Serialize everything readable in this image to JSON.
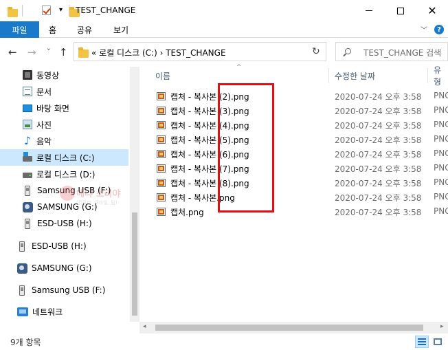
{
  "window": {
    "title": "TEST_CHANGE",
    "minimize_label": "minimize",
    "maximize_label": "maximize",
    "close_glyph": "✕"
  },
  "ribbon": {
    "tabs": [
      "파일",
      "홈",
      "공유",
      "보기"
    ],
    "expand_glyph": "﹀",
    "help_glyph": "?"
  },
  "nav": {
    "back_glyph": "←",
    "forward_glyph": "→",
    "history_glyph": "˅",
    "up_glyph": "↑",
    "refresh_glyph": "↻",
    "address_text": "«  로컬 디스크 (C:)  ›  TEST_CHANGE",
    "search_placeholder": "TEST_CHANGE 검색"
  },
  "sidebar": {
    "items": [
      {
        "label": "동영상",
        "icon": "video-icon"
      },
      {
        "label": "문서",
        "icon": "document-icon"
      },
      {
        "label": "바탕 화면",
        "icon": "desktop-icon"
      },
      {
        "label": "사진",
        "icon": "pictures-icon"
      },
      {
        "label": "음악",
        "icon": "music-icon"
      },
      {
        "label": "로컬 디스크 (C:)",
        "icon": "windows-drive-icon",
        "selected": true
      },
      {
        "label": "로컬 디스크 (D:)",
        "icon": "drive-icon"
      },
      {
        "label": "Samsung USB (F:)",
        "icon": "usb-drive-icon"
      },
      {
        "label": "SAMSUNG (G:)",
        "icon": "samsung-drive-icon"
      },
      {
        "label": "ESD-USB (H:)",
        "icon": "usb-drive-icon"
      },
      {
        "label": "ESD-USB (H:)",
        "icon": "usb-drive-icon"
      },
      {
        "label": "SAMSUNG (G:)",
        "icon": "samsung-drive-icon"
      },
      {
        "label": "Samsung USB (F:)",
        "icon": "usb-drive-icon"
      },
      {
        "label": "네트워크",
        "icon": "network-icon"
      }
    ]
  },
  "watermark": {
    "title": "메냐 소리야",
    "subtitle": "(컴퓨터, 모바일, 팁)"
  },
  "columns": {
    "name": "이름",
    "modified": "수정한 날짜",
    "type": "유형"
  },
  "files": [
    {
      "name": "캡처 - 복사본 (2).png",
      "modified": "2020-07-24 오후 3:58",
      "type": "PNG"
    },
    {
      "name": "캡처 - 복사본 (3).png",
      "modified": "2020-07-24 오후 3:58",
      "type": "PNG"
    },
    {
      "name": "캡처 - 복사본 (4).png",
      "modified": "2020-07-24 오후 3:58",
      "type": "PNG"
    },
    {
      "name": "캡처 - 복사본 (5).png",
      "modified": "2020-07-24 오후 3:58",
      "type": "PNG"
    },
    {
      "name": "캡처 - 복사본 (6).png",
      "modified": "2020-07-24 오후 3:58",
      "type": "PNG"
    },
    {
      "name": "캡처 - 복사본 (7).png",
      "modified": "2020-07-24 오후 3:58",
      "type": "PNG"
    },
    {
      "name": "캡처 - 복사본 (8).png",
      "modified": "2020-07-24 오후 3:58",
      "type": "PNG"
    },
    {
      "name": "캡처 - 복사본.png",
      "modified": "2020-07-24 오후 3:58",
      "type": "PNG"
    },
    {
      "name": "캡처.png",
      "modified": "2020-07-24 오후 3:58",
      "type": "PNG"
    }
  ],
  "status": {
    "item_count": "9개 항목"
  },
  "colors": {
    "accent": "#1979ca",
    "selection": "#cce8ff",
    "highlight_box": "#e01010"
  }
}
